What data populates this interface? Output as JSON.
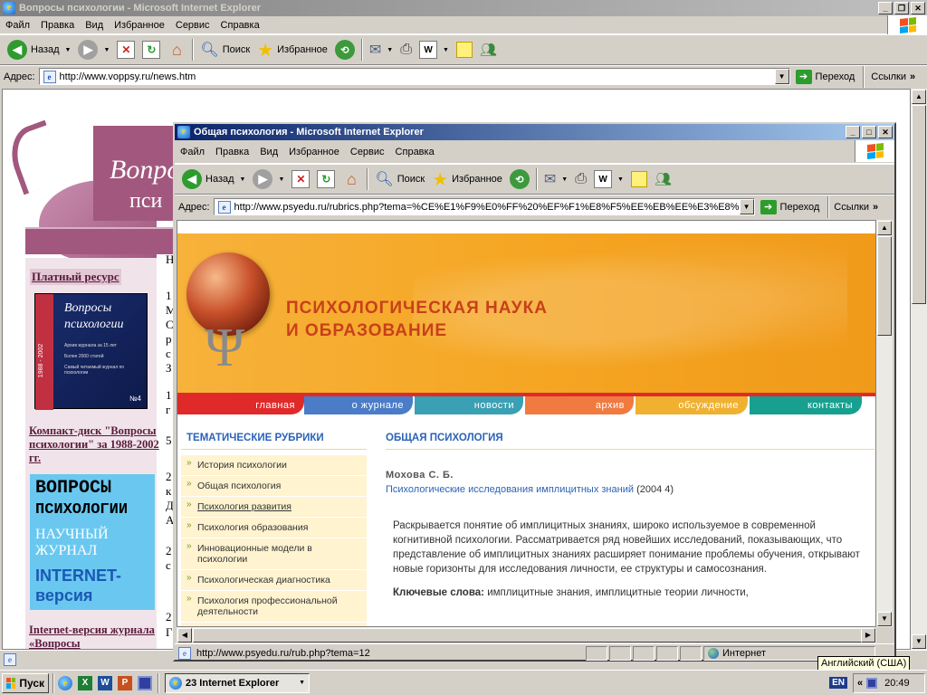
{
  "back_window": {
    "title": "Вопросы психологии - Microsoft Internet Explorer",
    "menu": [
      "Файл",
      "Правка",
      "Вид",
      "Избранное",
      "Сервис",
      "Справка"
    ],
    "toolbar": {
      "back": "Назад",
      "search": "Поиск",
      "favorites": "Избранное"
    },
    "address_label": "Адрес:",
    "address_value": "http://www.voppsy.ru/news.htm",
    "go_label": "Переход",
    "links_label": "Ссылки",
    "page": {
      "header_partial": [
        "Вопро",
        "пси"
      ],
      "paid_resource": "Платный ресурс",
      "book": {
        "title_1": "Вопросы",
        "title_2": "психологии",
        "years": "1988 - 2002",
        "lines": [
          "Архив журнала за 15 лет",
          "Более 2000 статей",
          "Самый читаемый журнал по психологии"
        ],
        "num": "№4"
      },
      "cd_link": "Компакт-диск \"Вопросы психологии\" за 1988-2002 гг.",
      "banner": {
        "l1": "ВОПРОСЫ",
        "l2": "ПСИХОЛОГИИ",
        "l3": "НАУЧНЫЙ",
        "l4": "ЖУРНАЛ",
        "l5": "INTERNET-",
        "l6": "версия"
      },
      "internet_link": "Internet-версия журнала «Вопросы",
      "right_chars": [
        "Н",
        "1",
        "М",
        "С",
        "р",
        "с",
        "З",
        "1",
        "г",
        "5",
        "2",
        "к",
        "Д",
        "А",
        "2",
        "с",
        "2",
        "Г"
      ]
    }
  },
  "front_window": {
    "title": "Общая психология - Microsoft Internet Explorer",
    "menu": [
      "Файл",
      "Правка",
      "Вид",
      "Избранное",
      "Сервис",
      "Справка"
    ],
    "toolbar": {
      "back": "Назад",
      "search": "Поиск",
      "favorites": "Избранное"
    },
    "address_label": "Адрес:",
    "address_value": "http://www.psyedu.ru/rubrics.php?tema=%CE%E1%F9%E0%FF%20%EF%F1%E8%F5%EE%EB%EE%E3%E8%",
    "go_label": "Переход",
    "links_label": "Ссылки",
    "status_url": "http://www.psyedu.ru/rub.php?tema=12",
    "status_zone": "Интернет"
  },
  "site": {
    "title_1": "ПСИХОЛОГИЧЕСКАЯ НАУКА",
    "title_2": "И ОБРАЗОВАНИЕ",
    "nav": [
      {
        "label": "главная",
        "color": "#e02a2a"
      },
      {
        "label": "о журнале",
        "color": "#4a7cc8"
      },
      {
        "label": "новости",
        "color": "#3aa0b4"
      },
      {
        "label": "архив",
        "color": "#f07a40"
      },
      {
        "label": "обсуждение",
        "color": "#f0b030"
      },
      {
        "label": "контакты",
        "color": "#17a090"
      }
    ],
    "rubrics_heading": "ТЕМАТИЧЕСКИЕ РУБРИКИ",
    "rubrics": [
      "История психологии",
      "Общая психология",
      "Психология развития",
      "Психология образования",
      "Инновационные модели в психологии",
      "Психологическая диагностика",
      "Психология профессиональной деятельности"
    ],
    "section_heading": "ОБЩАЯ ПСИХОЛОГИЯ",
    "author": "Мохова С. Б.",
    "article_title": "Психологические исследования имплицитных знаний",
    "article_meta": "(2004 4)",
    "abstract": "Раскрывается понятие об имплицитных знаниях, широко используемое в современной когнитивной психологии. Рассматривается ряд новейших исследований, показывающих, что представление об имплицитных знаниях расширяет понимание проблемы обучения, открывают новые горизонты для исследования личности, ее структуры и самосознания.",
    "keywords_label": "Ключевые слова:",
    "keywords": "имплицитные знания, имплицитные теории личности,"
  },
  "taskbar": {
    "start": "Пуск",
    "task": "23 Internet Explorer",
    "lang": "EN",
    "time": "20:49",
    "tooltip": "Английский (США)"
  },
  "colors": {
    "active_title": "#0a246a",
    "site_orange": "#f5a623",
    "site_blue": "#2a63b8"
  }
}
